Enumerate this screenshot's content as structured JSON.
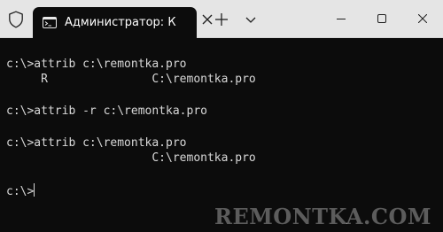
{
  "window": {
    "tab_title": "Администратор: К",
    "tab_icon": "terminal-icon",
    "titlebar_icon": "shield-icon",
    "new_tab_icon": "plus-icon",
    "dropdown_icon": "chevron-down-icon",
    "minimize_icon": "minimize-icon",
    "maximize_icon": "maximize-icon",
    "close_icon": "close-icon"
  },
  "terminal": {
    "lines": [
      "c:\\>attrib c:\\remontka.pro",
      "     R               C:\\remontka.pro",
      "",
      "c:\\>attrib -r c:\\remontka.pro",
      "",
      "c:\\>attrib c:\\remontka.pro",
      "                     C:\\remontka.pro",
      "",
      "c:\\>"
    ]
  },
  "watermark": "REMONTKA.COM",
  "colors": {
    "titlebar_bg": "#e5e5e5",
    "terminal_bg": "#0c0c0c",
    "text": "#d8d8d8"
  }
}
